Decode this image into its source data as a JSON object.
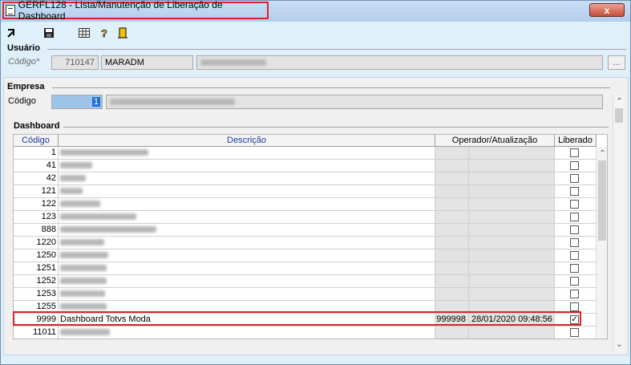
{
  "window": {
    "title": "GERFL128 - Lista/Manutenção de Liberação de Dashboard",
    "close_label": "x"
  },
  "toolbar": {
    "icons": [
      "exit-icon",
      "save-icon",
      "grid-icon",
      "help-icon",
      "door-icon"
    ]
  },
  "usuario": {
    "group_label": "Usuário",
    "code_label": "Código*",
    "code_value": "710147",
    "login": "MARADM",
    "lookup_label": "..."
  },
  "empresa": {
    "group_label": "Empresa",
    "code_label": "Código",
    "code_value": "1"
  },
  "dashboard": {
    "group_label": "Dashboard",
    "columns": {
      "code": "Código",
      "desc": "Descrição",
      "op": "Operador/Atualização",
      "lib": "Liberado"
    },
    "rows": [
      {
        "code": "1",
        "desc": "",
        "op": "",
        "upd": "",
        "checked": false
      },
      {
        "code": "41",
        "desc": "",
        "op": "",
        "upd": "",
        "checked": false
      },
      {
        "code": "42",
        "desc": "",
        "op": "",
        "upd": "",
        "checked": false
      },
      {
        "code": "121",
        "desc": "",
        "op": "",
        "upd": "",
        "checked": false
      },
      {
        "code": "122",
        "desc": "",
        "op": "",
        "upd": "",
        "checked": false
      },
      {
        "code": "123",
        "desc": "",
        "op": "",
        "upd": "",
        "checked": false
      },
      {
        "code": "888",
        "desc": "",
        "op": "",
        "upd": "",
        "checked": false
      },
      {
        "code": "1220",
        "desc": "",
        "op": "",
        "upd": "",
        "checked": false
      },
      {
        "code": "1250",
        "desc": "",
        "op": "",
        "upd": "",
        "checked": false
      },
      {
        "code": "1251",
        "desc": "",
        "op": "",
        "upd": "",
        "checked": false
      },
      {
        "code": "1252",
        "desc": "",
        "op": "",
        "upd": "",
        "checked": false
      },
      {
        "code": "1253",
        "desc": "",
        "op": "",
        "upd": "",
        "checked": false
      },
      {
        "code": "1255",
        "desc": "",
        "op": "",
        "upd": "",
        "checked": false
      },
      {
        "code": "9999",
        "desc": "Dashboard Totvs Moda",
        "op": "999998",
        "upd": "28/01/2020 09:48:56",
        "checked": true
      },
      {
        "code": "11011",
        "desc": "",
        "op": "",
        "upd": "",
        "checked": false
      }
    ]
  }
}
